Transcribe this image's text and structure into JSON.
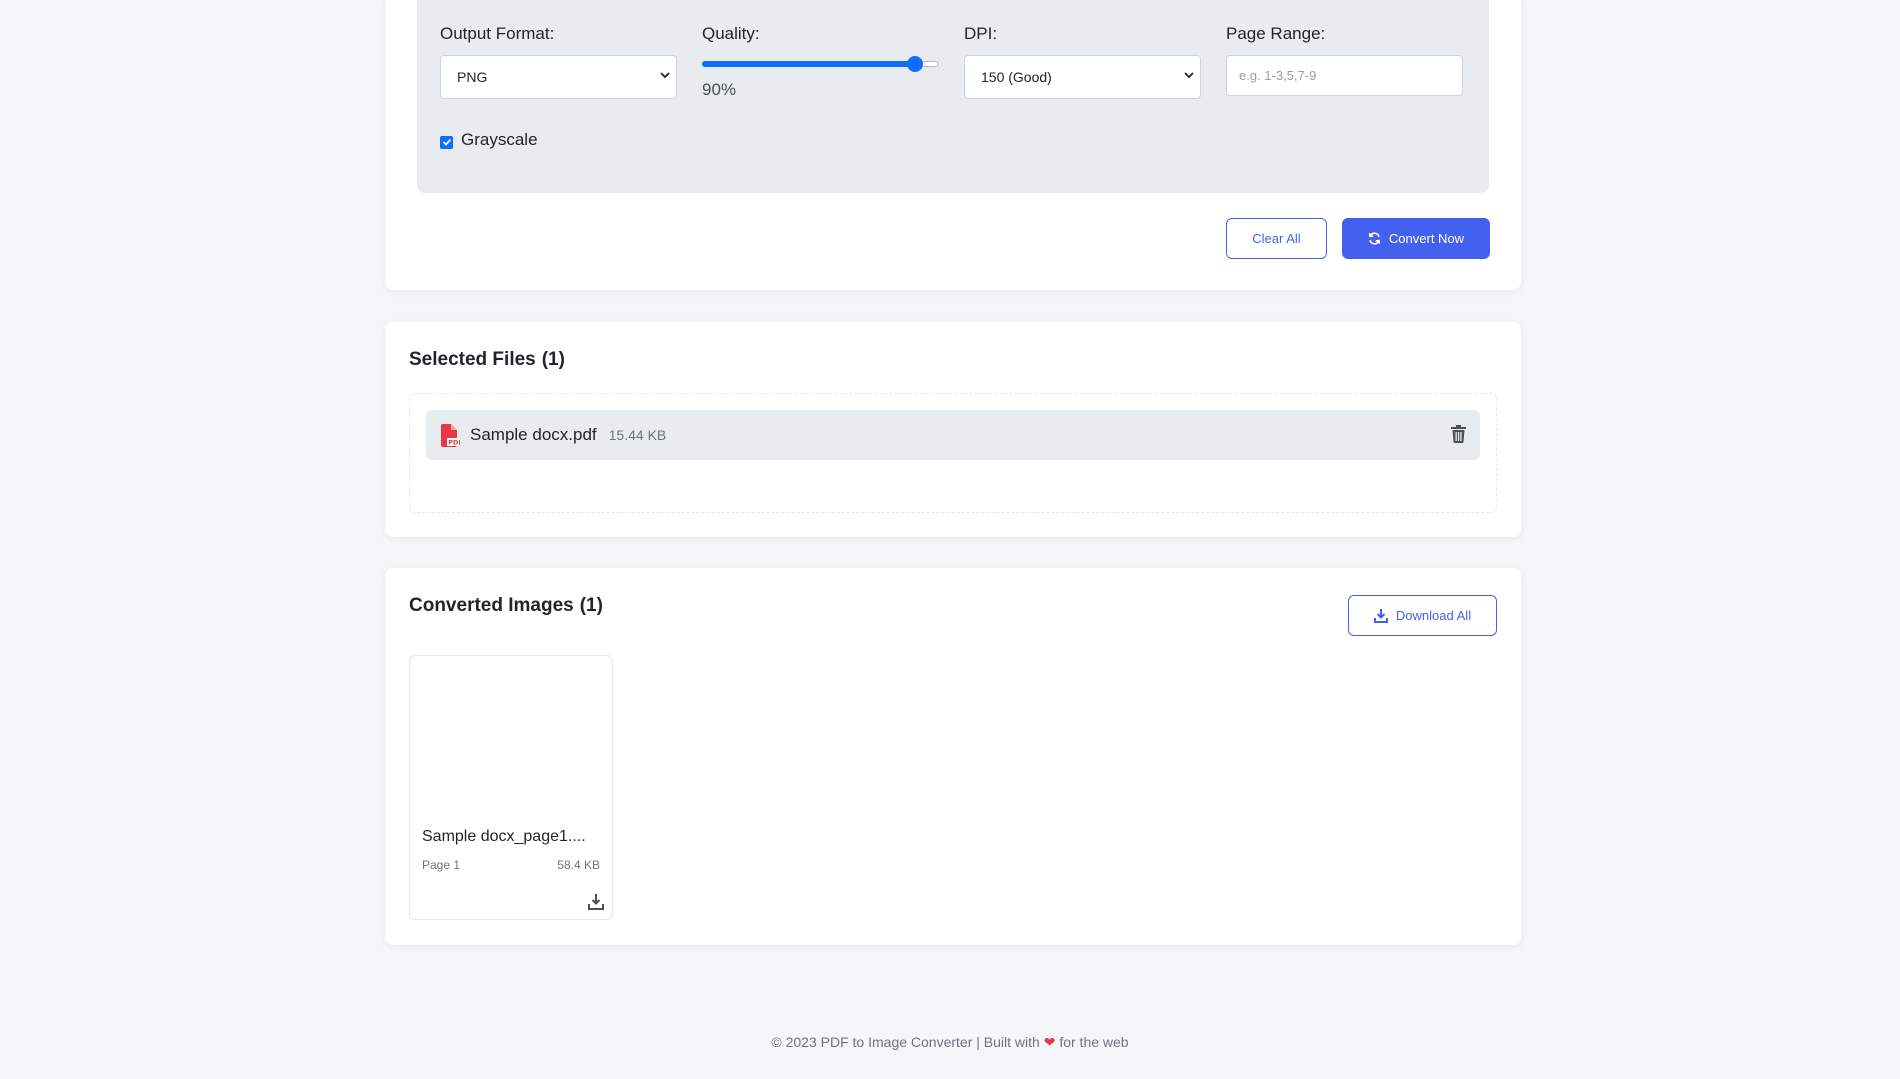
{
  "options": {
    "output_format": {
      "label": "Output Format:",
      "value": "PNG"
    },
    "quality": {
      "label": "Quality:",
      "value": 90,
      "value_text": "90%"
    },
    "dpi": {
      "label": "DPI:",
      "value": "150 (Good)"
    },
    "page_range": {
      "label": "Page Range:",
      "placeholder": "e.g. 1-3,5,7-9",
      "value": ""
    },
    "grayscale": {
      "label": "Grayscale",
      "checked": true
    }
  },
  "actions": {
    "clear_label": "Clear All",
    "convert_label": "Convert Now"
  },
  "selected_files": {
    "title": "Selected Files",
    "count": "(1)",
    "files": [
      {
        "name": "Sample docx.pdf",
        "size": "15.44 KB"
      }
    ]
  },
  "converted_images": {
    "title": "Converted Images",
    "count": "(1)",
    "download_all_label": "Download All",
    "images": [
      {
        "name": "Sample docx_page1....",
        "page": "Page 1",
        "size": "58.4 KB"
      }
    ]
  },
  "footer": {
    "before": "© 2023 PDF to Image Converter | Built with",
    "heart": "❤",
    "after": "for the web"
  },
  "colors": {
    "primary": "#4361ee",
    "slider": "#0d6efd",
    "pdf_icon": "#e63946",
    "panel_bg": "#e9ecef",
    "page_bg": "#f5f6f8"
  }
}
